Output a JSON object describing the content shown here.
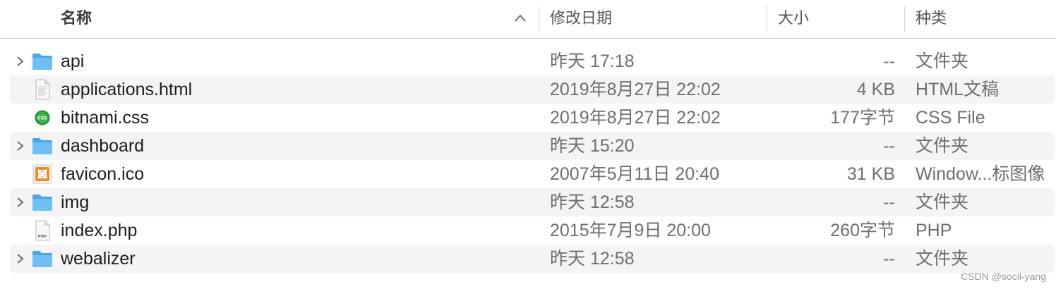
{
  "header": {
    "name": "名称",
    "date": "修改日期",
    "size": "大小",
    "kind": "种类"
  },
  "rows": [
    {
      "name": "api",
      "date": "昨天 17:18",
      "size": "--",
      "kind": "文件夹",
      "icon": "folder-icon",
      "expandable": true
    },
    {
      "name": "applications.html",
      "date": "2019年8月27日 22:02",
      "size": "4 KB",
      "kind": "HTML文稿",
      "icon": "html-file-icon",
      "expandable": false
    },
    {
      "name": "bitnami.css",
      "date": "2019年8月27日 22:02",
      "size": "177字节",
      "kind": "CSS File",
      "icon": "css-file-icon",
      "expandable": false
    },
    {
      "name": "dashboard",
      "date": "昨天 15:20",
      "size": "--",
      "kind": "文件夹",
      "icon": "folder-icon",
      "expandable": true
    },
    {
      "name": "favicon.ico",
      "date": "2007年5月11日 20:40",
      "size": "31 KB",
      "kind": "Window...标图像",
      "icon": "ico-file-icon",
      "expandable": false
    },
    {
      "name": "img",
      "date": "昨天 12:58",
      "size": "--",
      "kind": "文件夹",
      "icon": "folder-icon",
      "expandable": true
    },
    {
      "name": "index.php",
      "date": "2015年7月9日 20:00",
      "size": "260字节",
      "kind": "PHP",
      "icon": "php-file-icon",
      "expandable": false
    },
    {
      "name": "webalizer",
      "date": "昨天 12:58",
      "size": "--",
      "kind": "文件夹",
      "icon": "folder-icon",
      "expandable": true
    }
  ],
  "watermark": "CSDN @socil-yang"
}
